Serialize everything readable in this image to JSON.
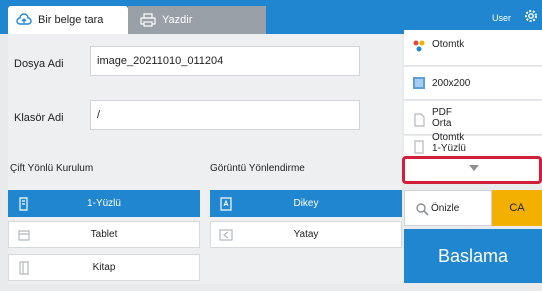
{
  "tabs": {
    "scan_label": "Bir belge tara",
    "print_label": "Yazdir"
  },
  "top": {
    "user_label": "User"
  },
  "fields": {
    "file_name_label": "Dosya Adi",
    "file_name_value": "image_20211010_011204",
    "folder_name_label": "Klasör Adi",
    "folder_name_value": "/"
  },
  "duplex": {
    "title": "Çift Yönlü Kurulum",
    "options": [
      {
        "label": "1-Yüzlü",
        "selected": true,
        "icon": "one-sided-icon"
      },
      {
        "label": "Tablet",
        "selected": false,
        "icon": "tablet-icon"
      },
      {
        "label": "Kitap",
        "selected": false,
        "icon": "book-icon"
      }
    ]
  },
  "orientation": {
    "title": "Görüntü Yönlendirme",
    "options": [
      {
        "label": "Dikey",
        "selected": true,
        "icon": "portrait-icon"
      },
      {
        "label": "Yatay",
        "selected": false,
        "icon": "landscape-icon"
      }
    ]
  },
  "right_panel": {
    "color_mode": "Otomtk",
    "resolution": "200x200",
    "format_line1": "PDF",
    "format_line2": "Orta",
    "sides_line1": "Otomtk",
    "sides_line2": "1-Yüzlü",
    "preview_label": "Önizle",
    "ca_label": "CA",
    "start_label": "Baslama"
  },
  "colors": {
    "accent": "#1f86cf",
    "ca": "#f4b000",
    "highlight": "#d11f3a"
  }
}
